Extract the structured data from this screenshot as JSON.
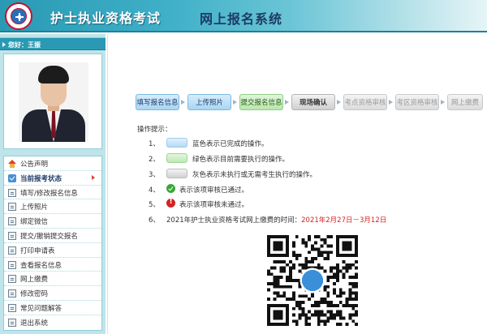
{
  "header": {
    "title": "护士执业资格考试",
    "subtitle": "网上报名系统"
  },
  "sidebar": {
    "greeting": "您好：王振",
    "items": [
      {
        "label": "公告声明",
        "icon": "house-icon"
      },
      {
        "label": "当前报考状态",
        "icon": "document-icon",
        "active": true
      },
      {
        "label": "填写/修改报名信息",
        "icon": "document-icon"
      },
      {
        "label": "上传照片",
        "icon": "document-icon"
      },
      {
        "label": "绑定微信",
        "icon": "document-icon"
      },
      {
        "label": "提交/撤销提交报名",
        "icon": "document-icon"
      },
      {
        "label": "打印申请表",
        "icon": "document-icon"
      },
      {
        "label": "查看报名信息",
        "icon": "document-icon"
      },
      {
        "label": "网上缴费",
        "icon": "document-icon"
      },
      {
        "label": "修改密码",
        "icon": "document-icon"
      },
      {
        "label": "常见问题解答",
        "icon": "document-icon"
      },
      {
        "label": "退出系统",
        "icon": "document-icon"
      }
    ]
  },
  "steps": [
    {
      "label": "填写报名信息",
      "status": "done"
    },
    {
      "label": "上传照片",
      "status": "done"
    },
    {
      "label": "提交报名信息",
      "status": "current"
    },
    {
      "label": "现场确认",
      "status": "pending"
    },
    {
      "label": "考点资格审核",
      "status": "disabled"
    },
    {
      "label": "考区资格审核",
      "status": "disabled"
    },
    {
      "label": "网上缴费",
      "status": "disabled"
    }
  ],
  "tips": {
    "title": "操作提示：",
    "items": [
      {
        "num": "1、",
        "text": "蓝色表示已完成的操作。"
      },
      {
        "num": "2、",
        "text": "绿色表示目前需要执行的操作。"
      },
      {
        "num": "3、",
        "text": "灰色表示未执行或无需考生执行的操作。"
      },
      {
        "num": "4、",
        "text": "表示该项审核已通过。"
      },
      {
        "num": "5、",
        "text": "表示该项审核未通过。"
      },
      {
        "num": "6、",
        "text": "2021年护士执业资格考试网上缴费的时间：",
        "highlight": "2021年2月27日－3月12日"
      }
    ]
  },
  "colors": {
    "header": "#2a9ab4",
    "done": "#a9d5f4",
    "current": "#b8e6ad",
    "pending": "#cfcfcf",
    "highlight": "#d32222"
  }
}
